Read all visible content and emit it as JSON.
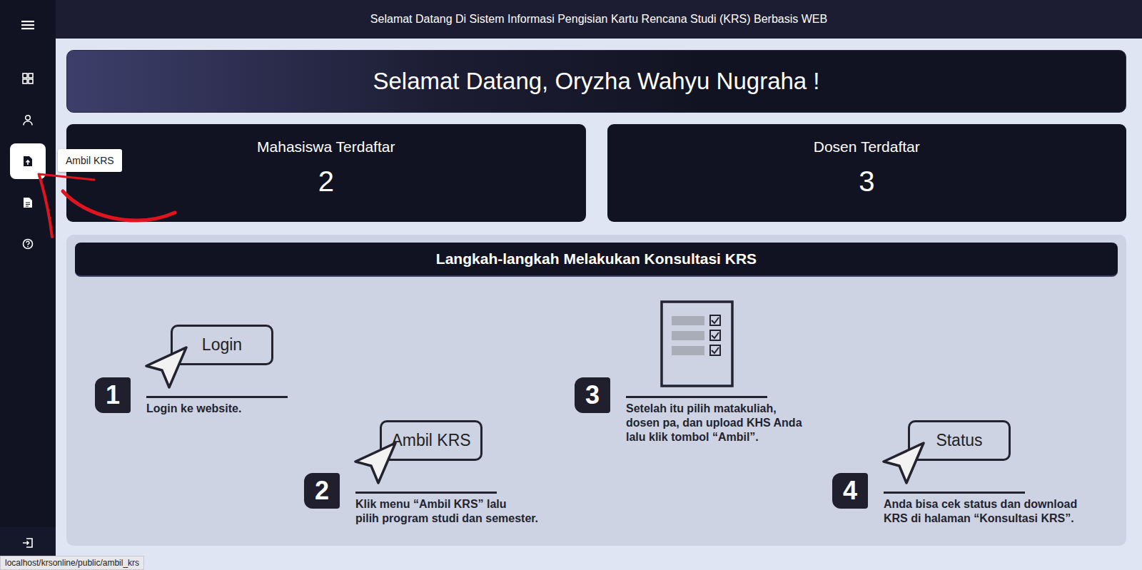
{
  "header": {
    "title": "Selamat Datang Di Sistem Informasi Pengisian Kartu Rencana Studi (KRS) Berbasis WEB"
  },
  "sidebar": {
    "items": [
      {
        "selected": false
      },
      {
        "selected": false
      },
      {
        "selected": true
      },
      {
        "selected": false
      },
      {
        "selected": false
      }
    ],
    "tooltip": "Ambil KRS"
  },
  "welcome": "Selamat Datang, Oryzha Wahyu Nugraha !",
  "stats": [
    {
      "label": "Mahasiswa Terdaftar",
      "value": "2"
    },
    {
      "label": "Dosen Terdaftar",
      "value": "3"
    }
  ],
  "steps_panel": {
    "title": "Langkah-langkah Melakukan Konsultasi KRS",
    "steps": [
      {
        "kind": "button",
        "number": "1",
        "button": "Login",
        "lines": [
          "Login ke website."
        ]
      },
      {
        "kind": "button",
        "number": "2",
        "button": "Ambil KRS",
        "lines": [
          "Klik menu “Ambil KRS” lalu",
          "pilih program studi dan semester."
        ]
      },
      {
        "kind": "document",
        "number": "3",
        "lines": [
          "Setelah itu pilih matakuliah,",
          "dosen pa, dan upload KHS Anda",
          "lalu klik tombol “Ambil”."
        ]
      },
      {
        "kind": "button",
        "number": "4",
        "button": "Status",
        "lines": [
          "Anda bisa cek status dan download",
          "KRS di halaman “Konsultasi KRS”."
        ]
      }
    ]
  },
  "status_bar": {
    "url": "localhost/krsonline/public/ambil_krs"
  }
}
